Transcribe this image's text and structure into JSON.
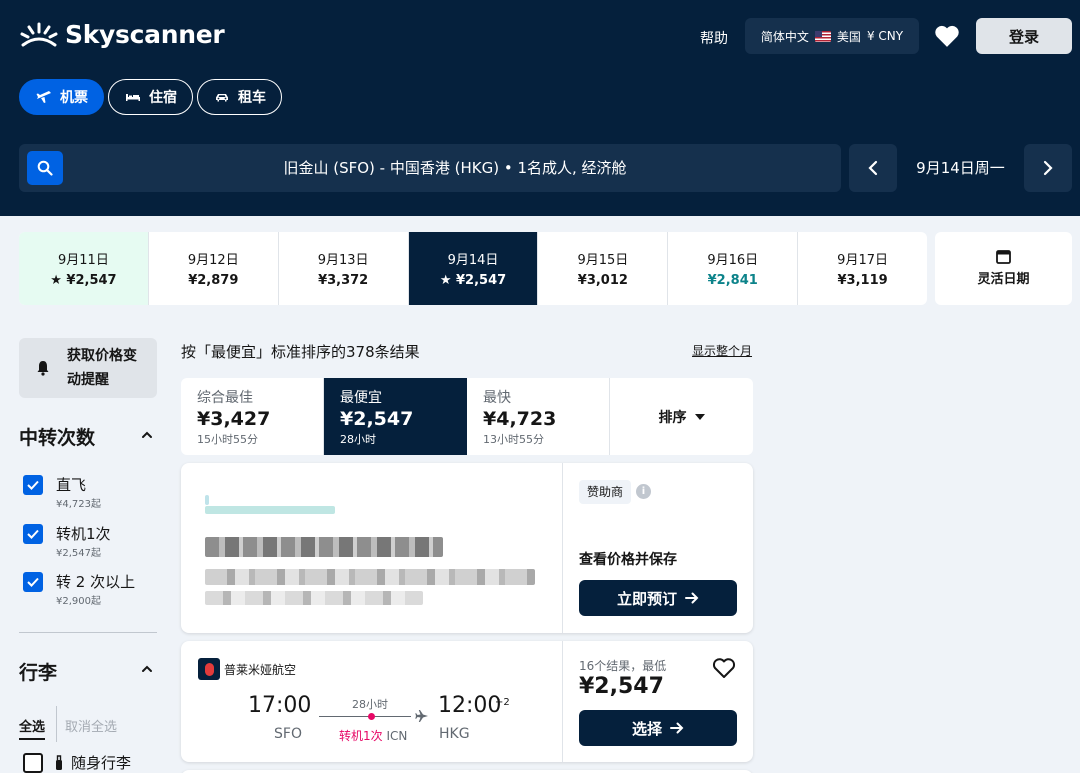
{
  "header": {
    "brand": "Skyscanner",
    "help": "帮助",
    "locale": {
      "language": "简体中文",
      "region": "美国",
      "currency": "¥ CNY"
    },
    "login": "登录",
    "nav": [
      {
        "label": "机票",
        "icon": "plane-icon",
        "active": true
      },
      {
        "label": "住宿",
        "icon": "bed-icon",
        "active": false
      },
      {
        "label": "租车",
        "icon": "car-icon",
        "active": false
      }
    ],
    "search": {
      "summary": "旧金山 (SFO) - 中国香港 (HKG) • 1名成人, 经济舱"
    },
    "current_date": "9月14日周一"
  },
  "date_strip": [
    {
      "date": "9月11日",
      "price": "★ ¥2,547"
    },
    {
      "date": "9月12日",
      "price": "¥2,879"
    },
    {
      "date": "9月13日",
      "price": "¥3,372"
    },
    {
      "date": "9月14日",
      "price": "★ ¥2,547"
    },
    {
      "date": "9月15日",
      "price": "¥3,012"
    },
    {
      "date": "9月16日",
      "price": "¥2,841"
    },
    {
      "date": "9月17日",
      "price": "¥3,119"
    }
  ],
  "flexible_dates": "灵活日期",
  "sidebar": {
    "price_alert": "获取价格变动提醒",
    "stops_title": "中转次数",
    "stops": [
      {
        "label": "直飞",
        "price": "¥4,723起",
        "checked": true
      },
      {
        "label": "转机1次",
        "price": "¥2,547起",
        "checked": true
      },
      {
        "label": "转 2 次以上",
        "price": "¥2,900起",
        "checked": true
      }
    ],
    "baggage_title": "行李",
    "select_all": "全选",
    "deselect_all": "取消全选",
    "carry_on": "随身行李"
  },
  "results": {
    "count_text": "按「最便宜」标准排序的378条结果",
    "month_link": "显示整个月",
    "sort_tabs": [
      {
        "label": "综合最佳",
        "price": "¥3,427",
        "duration": "15小时55分"
      },
      {
        "label": "最便宜",
        "price": "¥2,547",
        "duration": "28小时"
      },
      {
        "label": "最快",
        "price": "¥4,723",
        "duration": "13小时55分"
      }
    ],
    "sort_label": "排序"
  },
  "sponsored": {
    "badge": "赞助商",
    "info": "i",
    "prompt": "查看价格并保存",
    "button": "立即预订"
  },
  "flight": {
    "airline": "普莱米娅航空",
    "dep_time": "17:00",
    "dep_code": "SFO",
    "arr_time": "12:00",
    "plus_day": "+2",
    "arr_code": "HKG",
    "duration": "28小时",
    "stops": "转机1次",
    "via": "ICN",
    "result_count": "16个结果，最低",
    "price": "¥2,547",
    "button": "选择"
  },
  "colors": {
    "navy": "#05203c",
    "blue": "#0062e3",
    "cheap_bg": "#e6fbf2",
    "green_price": "#0c838a",
    "stop_pink": "#e70866"
  }
}
